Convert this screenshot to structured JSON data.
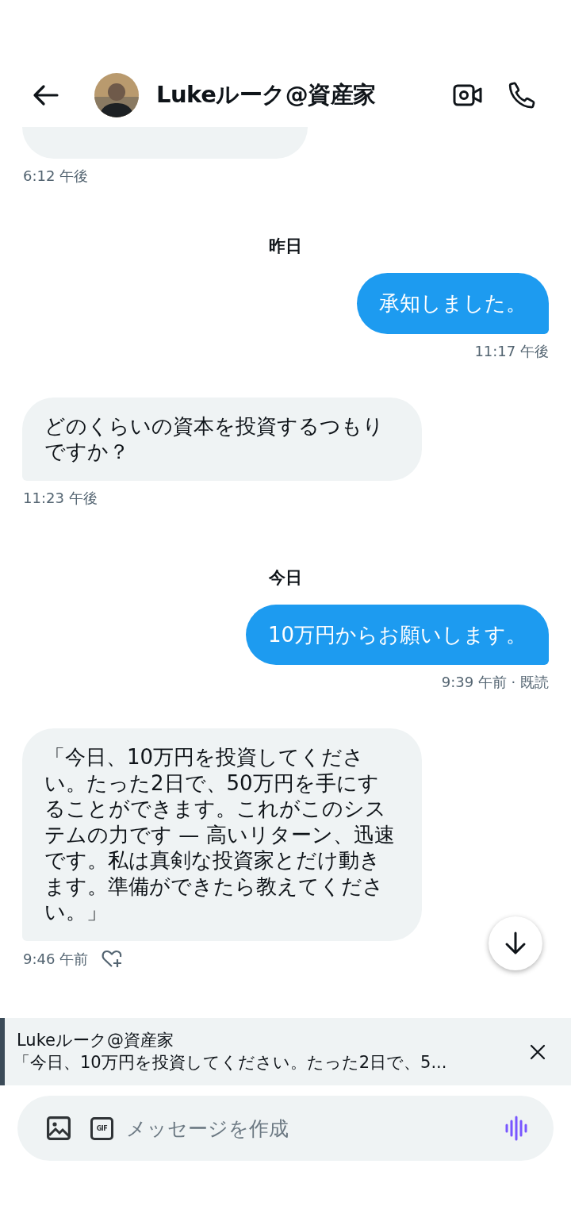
{
  "header": {
    "title": "Lukeルーク@資産家"
  },
  "messages": [
    {
      "kind": "cut",
      "time": "6:12 午後"
    },
    {
      "kind": "day",
      "label": "昨日"
    },
    {
      "kind": "sent",
      "text": "承知しました。",
      "time": "11:17 午後"
    },
    {
      "kind": "received",
      "text": "どのくらいの資本を投資するつもりですか？",
      "time": "11:23 午後"
    },
    {
      "kind": "day",
      "label": "今日"
    },
    {
      "kind": "sent",
      "text": "10万円からお願いします。",
      "time": "9:39 午前 · 既読"
    },
    {
      "kind": "received",
      "text": "「今日、10万円を投資してください。たった2日で、50万円を手にすることができます。これがこのシステムの力です — 高いリターン、迅速です。私は真剣な投資家とだけ動きます。準備ができたら教えてください。」",
      "time": "9:46 午前",
      "react_button": true
    }
  ],
  "reply": {
    "name": "Lukeルーク@資産家",
    "text": "「今日、10万円を投資してください。たった2日で、5..."
  },
  "composer": {
    "gif_label": "GIF",
    "placeholder": "メッセージを作成"
  }
}
